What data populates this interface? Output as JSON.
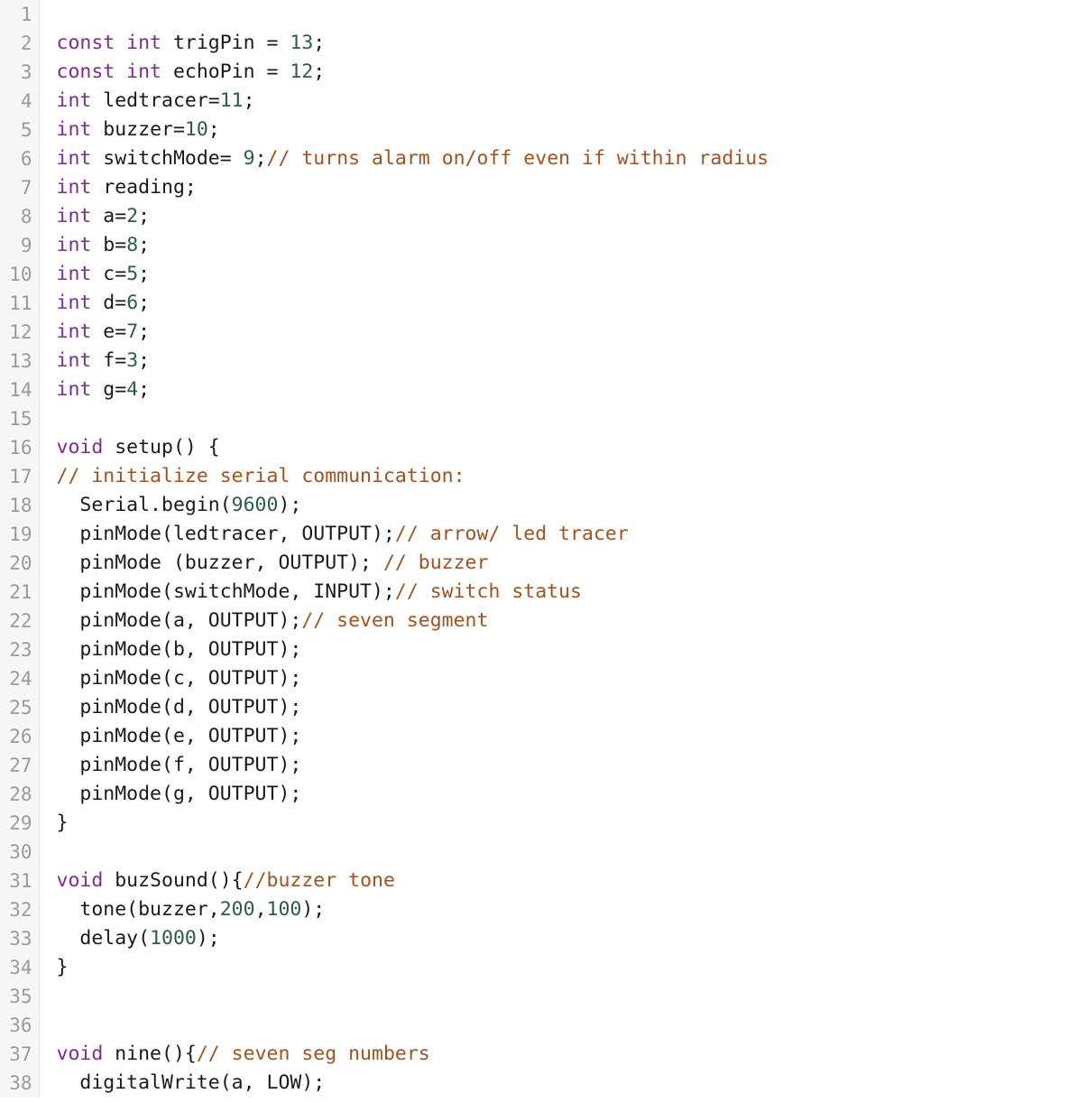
{
  "editor": {
    "language": "arduino-cpp",
    "background_color": "#ffffff",
    "gutter_color": "#f7f7f7",
    "gutter_border_color": "#e2e2e2",
    "line_number_color": "#9b9b9b",
    "first_visible_line": 1,
    "last_visible_line": 38,
    "total_visible_lines": 38
  },
  "theme": {
    "keyword_color": "#7c2d8e",
    "number_color": "#2d5c42",
    "comment_color": "#a0521f",
    "plain_text_color": "#1a1a1a"
  },
  "lines": [
    {
      "number": "1",
      "tokens": []
    },
    {
      "number": "2",
      "tokens": [
        {
          "t": "kw",
          "v": "const int"
        },
        {
          "t": "txt",
          "v": " trigPin = "
        },
        {
          "t": "num",
          "v": "13"
        },
        {
          "t": "txt",
          "v": ";"
        }
      ]
    },
    {
      "number": "3",
      "tokens": [
        {
          "t": "kw",
          "v": "const int"
        },
        {
          "t": "txt",
          "v": " echoPin = "
        },
        {
          "t": "num",
          "v": "12"
        },
        {
          "t": "txt",
          "v": ";"
        }
      ]
    },
    {
      "number": "4",
      "tokens": [
        {
          "t": "kw",
          "v": "int"
        },
        {
          "t": "txt",
          "v": " ledtracer="
        },
        {
          "t": "num",
          "v": "11"
        },
        {
          "t": "txt",
          "v": ";"
        }
      ]
    },
    {
      "number": "5",
      "tokens": [
        {
          "t": "kw",
          "v": "int"
        },
        {
          "t": "txt",
          "v": " buzzer="
        },
        {
          "t": "num",
          "v": "10"
        },
        {
          "t": "txt",
          "v": ";"
        }
      ]
    },
    {
      "number": "6",
      "tokens": [
        {
          "t": "kw",
          "v": "int"
        },
        {
          "t": "txt",
          "v": " switchMode= "
        },
        {
          "t": "num",
          "v": "9"
        },
        {
          "t": "txt",
          "v": ";"
        },
        {
          "t": "com",
          "v": "// turns alarm on/off even if within radius"
        }
      ]
    },
    {
      "number": "7",
      "tokens": [
        {
          "t": "kw",
          "v": "int"
        },
        {
          "t": "txt",
          "v": " reading;"
        }
      ]
    },
    {
      "number": "8",
      "tokens": [
        {
          "t": "kw",
          "v": "int"
        },
        {
          "t": "txt",
          "v": " a="
        },
        {
          "t": "num",
          "v": "2"
        },
        {
          "t": "txt",
          "v": ";"
        }
      ]
    },
    {
      "number": "9",
      "tokens": [
        {
          "t": "kw",
          "v": "int"
        },
        {
          "t": "txt",
          "v": " b="
        },
        {
          "t": "num",
          "v": "8"
        },
        {
          "t": "txt",
          "v": ";"
        }
      ]
    },
    {
      "number": "10",
      "tokens": [
        {
          "t": "kw",
          "v": "int"
        },
        {
          "t": "txt",
          "v": " c="
        },
        {
          "t": "num",
          "v": "5"
        },
        {
          "t": "txt",
          "v": ";"
        }
      ]
    },
    {
      "number": "11",
      "tokens": [
        {
          "t": "kw",
          "v": "int"
        },
        {
          "t": "txt",
          "v": " d="
        },
        {
          "t": "num",
          "v": "6"
        },
        {
          "t": "txt",
          "v": ";"
        }
      ]
    },
    {
      "number": "12",
      "tokens": [
        {
          "t": "kw",
          "v": "int"
        },
        {
          "t": "txt",
          "v": " e="
        },
        {
          "t": "num",
          "v": "7"
        },
        {
          "t": "txt",
          "v": ";"
        }
      ]
    },
    {
      "number": "13",
      "tokens": [
        {
          "t": "kw",
          "v": "int"
        },
        {
          "t": "txt",
          "v": " f="
        },
        {
          "t": "num",
          "v": "3"
        },
        {
          "t": "txt",
          "v": ";"
        }
      ]
    },
    {
      "number": "14",
      "tokens": [
        {
          "t": "kw",
          "v": "int"
        },
        {
          "t": "txt",
          "v": " g="
        },
        {
          "t": "num",
          "v": "4"
        },
        {
          "t": "txt",
          "v": ";"
        }
      ]
    },
    {
      "number": "15",
      "tokens": []
    },
    {
      "number": "16",
      "tokens": [
        {
          "t": "kw",
          "v": "void"
        },
        {
          "t": "txt",
          "v": " setup() {"
        }
      ]
    },
    {
      "number": "17",
      "tokens": [
        {
          "t": "com",
          "v": "// initialize serial communication:"
        }
      ]
    },
    {
      "number": "18",
      "tokens": [
        {
          "t": "txt",
          "v": "  Serial.begin("
        },
        {
          "t": "num",
          "v": "9600"
        },
        {
          "t": "txt",
          "v": ");"
        }
      ]
    },
    {
      "number": "19",
      "tokens": [
        {
          "t": "txt",
          "v": "  pinMode(ledtracer, OUTPUT);"
        },
        {
          "t": "com",
          "v": "// arrow/ led tracer"
        }
      ]
    },
    {
      "number": "20",
      "tokens": [
        {
          "t": "txt",
          "v": "  pinMode (buzzer, OUTPUT); "
        },
        {
          "t": "com",
          "v": "// buzzer"
        }
      ]
    },
    {
      "number": "21",
      "tokens": [
        {
          "t": "txt",
          "v": "  pinMode(switchMode, INPUT);"
        },
        {
          "t": "com",
          "v": "// switch status"
        }
      ]
    },
    {
      "number": "22",
      "tokens": [
        {
          "t": "txt",
          "v": "  pinMode(a, OUTPUT);"
        },
        {
          "t": "com",
          "v": "// seven segment"
        }
      ]
    },
    {
      "number": "23",
      "tokens": [
        {
          "t": "txt",
          "v": "  pinMode(b, OUTPUT);"
        }
      ]
    },
    {
      "number": "24",
      "tokens": [
        {
          "t": "txt",
          "v": "  pinMode(c, OUTPUT);"
        }
      ]
    },
    {
      "number": "25",
      "tokens": [
        {
          "t": "txt",
          "v": "  pinMode(d, OUTPUT);"
        }
      ]
    },
    {
      "number": "26",
      "tokens": [
        {
          "t": "txt",
          "v": "  pinMode(e, OUTPUT);"
        }
      ]
    },
    {
      "number": "27",
      "tokens": [
        {
          "t": "txt",
          "v": "  pinMode(f, OUTPUT);"
        }
      ]
    },
    {
      "number": "28",
      "tokens": [
        {
          "t": "txt",
          "v": "  pinMode(g, OUTPUT);"
        }
      ]
    },
    {
      "number": "29",
      "tokens": [
        {
          "t": "txt",
          "v": "}"
        }
      ]
    },
    {
      "number": "30",
      "tokens": []
    },
    {
      "number": "31",
      "tokens": [
        {
          "t": "kw",
          "v": "void"
        },
        {
          "t": "txt",
          "v": " buzSound(){"
        },
        {
          "t": "com",
          "v": "//buzzer tone"
        }
      ]
    },
    {
      "number": "32",
      "tokens": [
        {
          "t": "txt",
          "v": "  tone(buzzer,"
        },
        {
          "t": "num",
          "v": "200"
        },
        {
          "t": "txt",
          "v": ","
        },
        {
          "t": "num",
          "v": "100"
        },
        {
          "t": "txt",
          "v": ");"
        }
      ]
    },
    {
      "number": "33",
      "tokens": [
        {
          "t": "txt",
          "v": "  delay("
        },
        {
          "t": "num",
          "v": "1000"
        },
        {
          "t": "txt",
          "v": ");"
        }
      ]
    },
    {
      "number": "34",
      "tokens": [
        {
          "t": "txt",
          "v": "}"
        }
      ]
    },
    {
      "number": "35",
      "tokens": []
    },
    {
      "number": "36",
      "tokens": []
    },
    {
      "number": "37",
      "tokens": [
        {
          "t": "kw",
          "v": "void"
        },
        {
          "t": "txt",
          "v": " nine(){"
        },
        {
          "t": "com",
          "v": "// seven seg numbers"
        }
      ]
    },
    {
      "number": "38",
      "tokens": [
        {
          "t": "txt",
          "v": "  digitalWrite(a, LOW);"
        }
      ]
    }
  ]
}
